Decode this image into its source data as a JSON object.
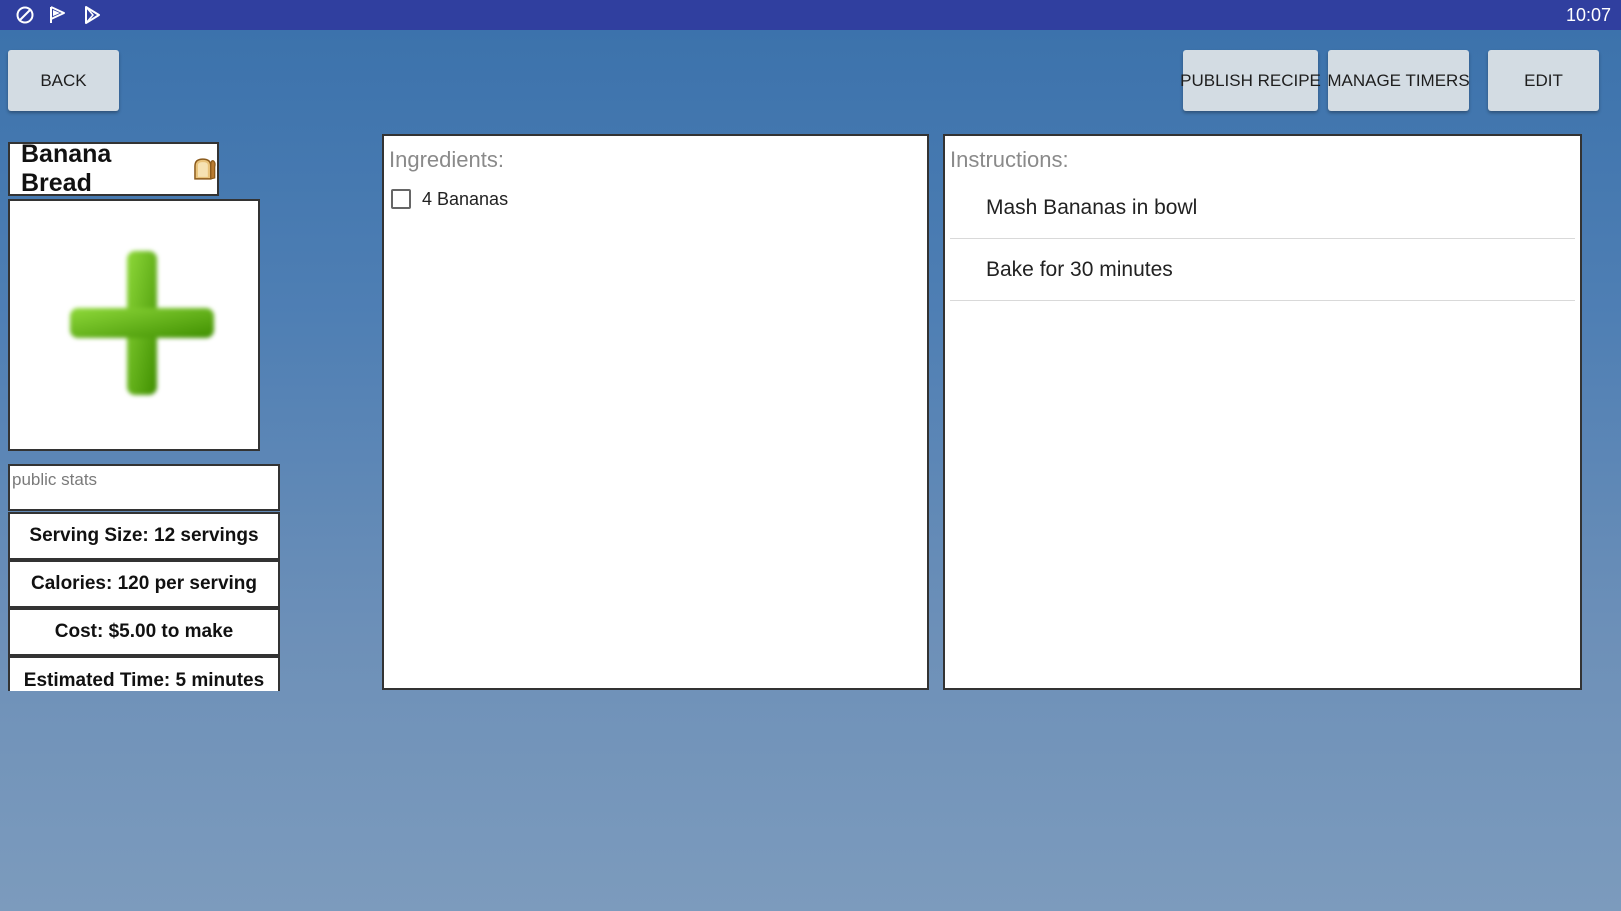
{
  "status_bar": {
    "time": "10:07",
    "icons": [
      "sync-off-icon",
      "play-store-flag-icon",
      "play-store-icon"
    ]
  },
  "toolbar": {
    "back_label": "Back",
    "publish_label": "Publish Recipe",
    "manage_timers_label": "Manage Timers",
    "edit_label": "Edit"
  },
  "recipe": {
    "title": "Banana Bread",
    "title_icon": "bread-icon",
    "image_icon": "add-image-plus-icon"
  },
  "stats": {
    "label": "public stats",
    "items": [
      "Serving Size: 12 servings",
      "Calories: 120 per serving",
      "Cost: $5.00 to make",
      "Estimated Time: 5 minutes"
    ]
  },
  "ingredients": {
    "title": "Ingredients:",
    "items": [
      {
        "text": "4 Bananas",
        "checked": false
      }
    ]
  },
  "instructions": {
    "title": "Instructions:",
    "items": [
      "Mash Bananas in bowl",
      "Bake for 30 minutes"
    ]
  },
  "colors": {
    "status_bar": "#303f9f",
    "button_bg": "#d3dce3",
    "background_top": "#3a71ab",
    "background_bottom": "#7c9bbd",
    "plus_green": "#5cb800"
  }
}
